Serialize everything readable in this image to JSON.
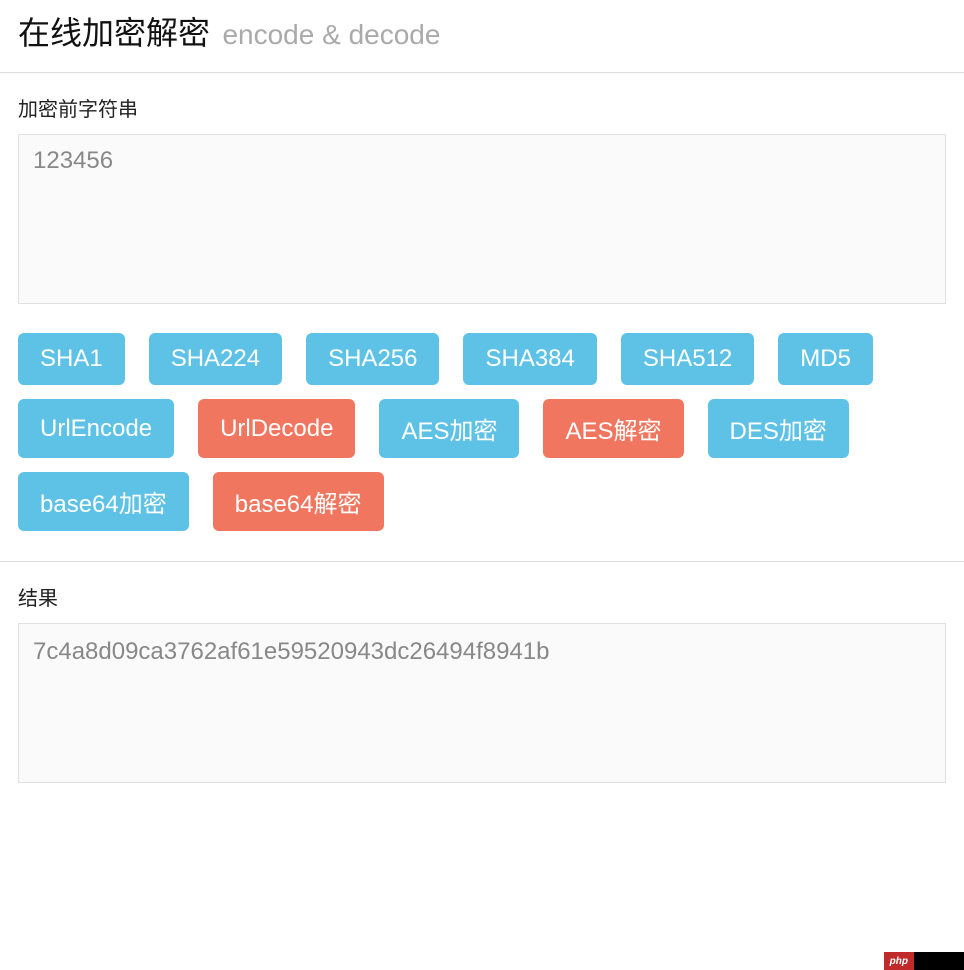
{
  "header": {
    "title": "在线加密解密",
    "subtitle": "encode & decode"
  },
  "input": {
    "label": "加密前字符串",
    "value": "123456"
  },
  "buttons": {
    "row1": [
      {
        "label": "SHA1",
        "variant": "blue"
      },
      {
        "label": "SHA224",
        "variant": "blue"
      },
      {
        "label": "SHA256",
        "variant": "blue"
      },
      {
        "label": "SHA384",
        "variant": "blue"
      },
      {
        "label": "SHA512",
        "variant": "blue"
      },
      {
        "label": "MD5",
        "variant": "blue"
      }
    ],
    "row2": [
      {
        "label": "UrlEncode",
        "variant": "blue"
      },
      {
        "label": "UrlDecode",
        "variant": "red"
      },
      {
        "label": "AES加密",
        "variant": "blue"
      },
      {
        "label": "AES解密",
        "variant": "red"
      },
      {
        "label": "DES加密",
        "variant": "blue"
      }
    ],
    "row3": [
      {
        "label": "base64加密",
        "variant": "blue"
      },
      {
        "label": "base64解密",
        "variant": "red"
      }
    ]
  },
  "result": {
    "label": "结果",
    "value": "7c4a8d09ca3762af61e59520943dc26494f8941b"
  },
  "footer": {
    "badge": "php"
  }
}
